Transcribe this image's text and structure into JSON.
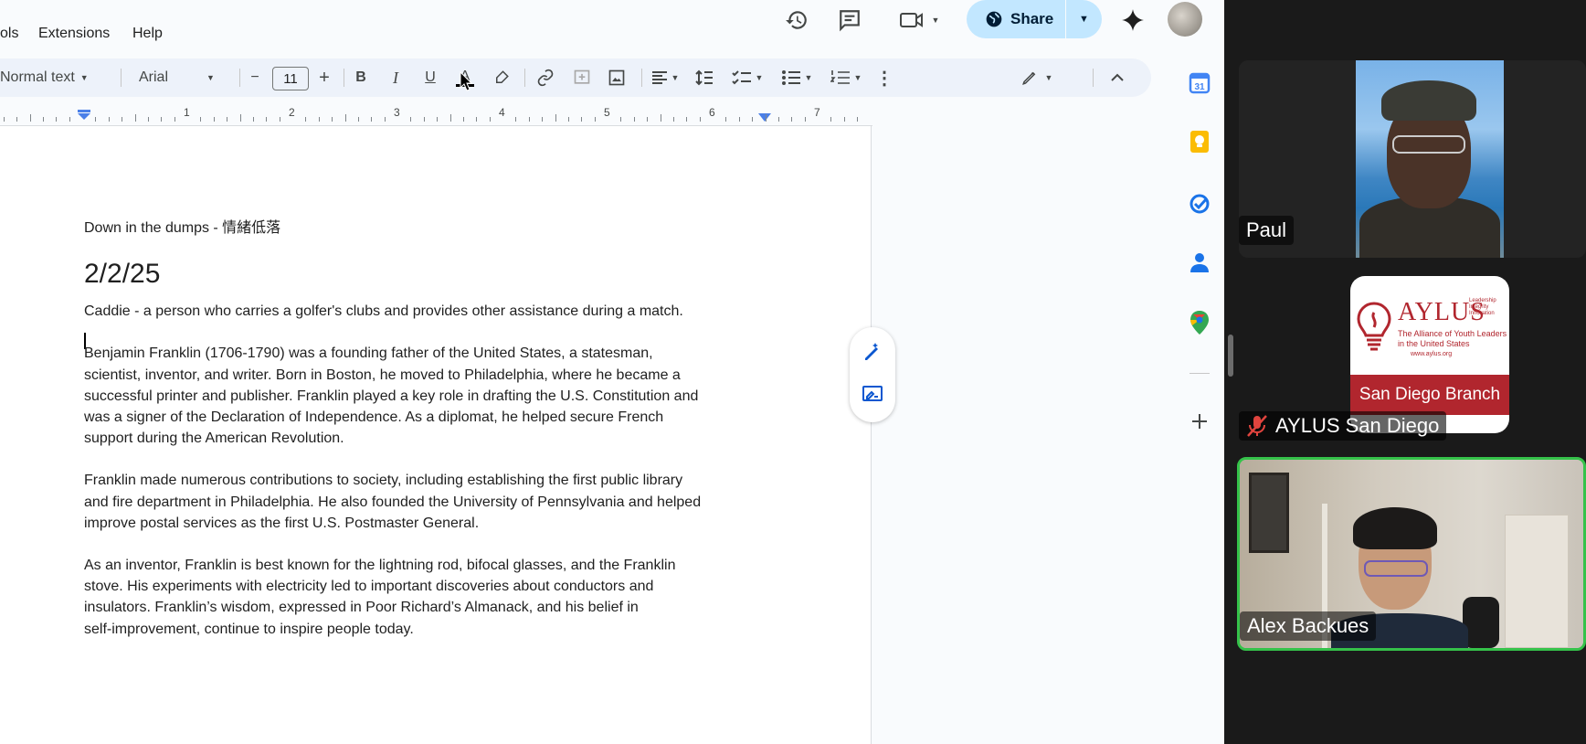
{
  "menu": {
    "tools": "ols",
    "extensions": "Extensions",
    "help": "Help"
  },
  "header": {
    "share_label": "Share"
  },
  "toolbar": {
    "style": "Normal text",
    "font": "Arial",
    "minus": "−",
    "font_size": "11",
    "plus": "+",
    "bold": "B",
    "italic": "I",
    "underline": "U",
    "text_color": "A"
  },
  "ruler": {
    "labels": [
      "1",
      "2",
      "3",
      "4",
      "5",
      "6",
      "7"
    ]
  },
  "document": {
    "line1": "Down in the dumps - 情緒低落",
    "date_heading": "2/2/25",
    "line_caddie": "Caddie - a person who carries a golfer's clubs and provides other assistance during a match.",
    "para1": [
      "Benjamin Franklin (1706-1790) was a founding father of the United States, a statesman,",
      "scientist, inventor, and writer. Born in Boston, he moved to Philadelphia, where he became a",
      "successful printer and publisher. Franklin played a key role in drafting the U.S. Constitution and",
      "was a signer of the Declaration of Independence. As a diplomat, he helped secure French",
      "support during the American Revolution."
    ],
    "para2": [
      "Franklin made numerous contributions to society, including establishing the first public library",
      "and fire department in Philadelphia. He also founded the University of Pennsylvania and helped",
      "improve postal services as the first U.S. Postmaster General."
    ],
    "para3": [
      "As an inventor, Franklin is best known for the lightning rod, bifocal glasses, and the Franklin",
      "stove. His experiments with electricity led to important discoveries about conductors and",
      "insulators. Franklin’s wisdom, expressed in Poor Richard’s Almanack, and his belief in",
      "self-improvement, continue to inspire people today."
    ]
  },
  "rail": {
    "calendar_day": "31"
  },
  "zoom": {
    "participants": [
      {
        "name": "Paul"
      },
      {
        "name": "AYLUS San Diego"
      },
      {
        "name": "Alex Backues"
      }
    ],
    "aylus_logo": {
      "title": "AYLUS",
      "motto": [
        "Leadership",
        "Integrity",
        "Innovation"
      ],
      "subtitle": "The Alliance of Youth Leaders in the United States",
      "url": "www.aylus.org",
      "branch": "San Diego Branch"
    }
  },
  "colors": {
    "share_bg": "#c2e7ff",
    "toolbar_bg": "#edf2fa",
    "aylus_red": "#b1262e",
    "active_speaker": "#35c24a",
    "mic_muted": "#e0443e"
  }
}
